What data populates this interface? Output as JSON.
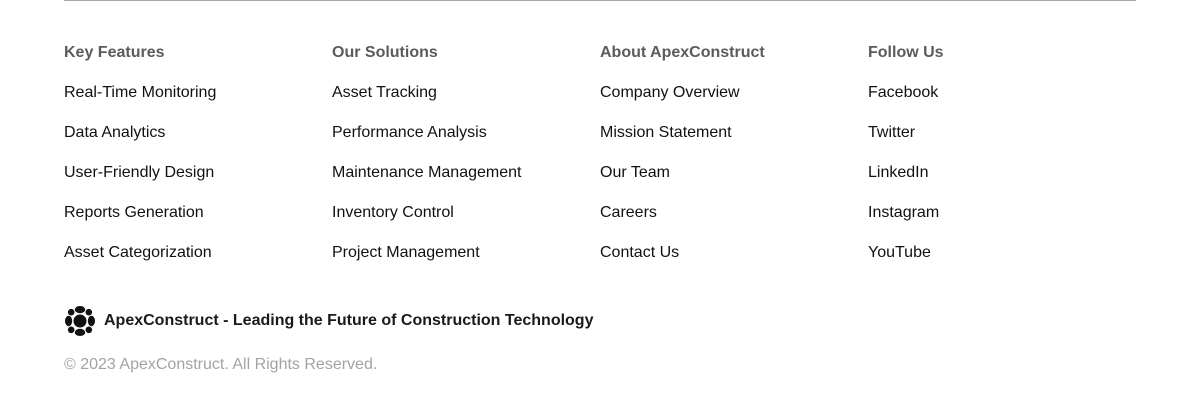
{
  "footer": {
    "columns": [
      {
        "heading": "Key Features",
        "links": [
          "Real-Time Monitoring",
          "Data Analytics",
          "User-Friendly Design",
          "Reports Generation",
          "Asset Categorization"
        ]
      },
      {
        "heading": "Our Solutions",
        "links": [
          "Asset Tracking",
          "Performance Analysis",
          "Maintenance Management",
          "Inventory Control",
          "Project Management"
        ]
      },
      {
        "heading": "About ApexConstruct",
        "links": [
          "Company Overview",
          "Mission Statement",
          "Our Team",
          "Careers",
          "Contact Us"
        ]
      },
      {
        "heading": "Follow Us",
        "links": [
          "Facebook",
          "Twitter",
          "LinkedIn",
          "Instagram",
          "YouTube"
        ]
      }
    ],
    "brand": {
      "logo_icon": "apexconstruct-logo-icon",
      "tagline": "ApexConstruct - Leading the Future of Construction Technology"
    },
    "copyright": "© 2023 ApexConstruct. All Rights Reserved.",
    "colors": {
      "heading": "#5b5b5b",
      "link": "#111111",
      "muted": "#a3a3a3",
      "divider": "#a8a8a8"
    }
  }
}
